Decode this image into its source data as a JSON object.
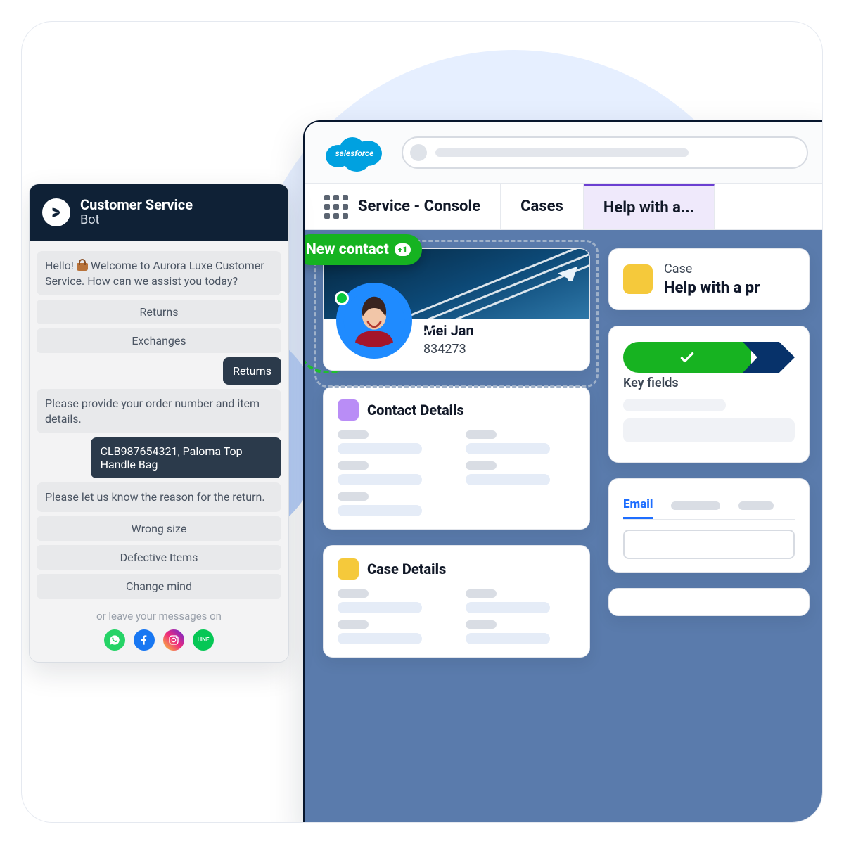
{
  "chat": {
    "title": "Customer Service",
    "subtitle": "Bot",
    "greeting": "Hello! 👜 Welcome to Aurora Luxe Customer Service. How can we assist you today?",
    "options1": [
      "Returns",
      "Exchanges"
    ],
    "user1": "Returns",
    "bot2": "Please provide your order number and item details.",
    "user2": "CLB987654321, Paloma Top Handle Bag",
    "bot3": "Please let us know the reason for the return.",
    "options2": [
      "Wrong size",
      "Defective Items",
      "Change mind"
    ],
    "footer_hint": "or leave your messages on",
    "socials": [
      "whatsapp",
      "facebook",
      "instagram",
      "line"
    ]
  },
  "sf": {
    "brand": "salesforce",
    "tabs": {
      "main": "Service - Console",
      "t2": "Cases",
      "t3": "Help with a..."
    },
    "new_contact": {
      "label": "New contact",
      "count": "+1"
    },
    "contact": {
      "name": "Mei Jan",
      "id": "834273"
    },
    "sections": {
      "contact_details": "Contact Details",
      "case_details": "Case Details"
    },
    "case": {
      "label": "Case",
      "title": "Help with a pr"
    },
    "key_fields": "Key fields",
    "email_tab": "Email"
  }
}
